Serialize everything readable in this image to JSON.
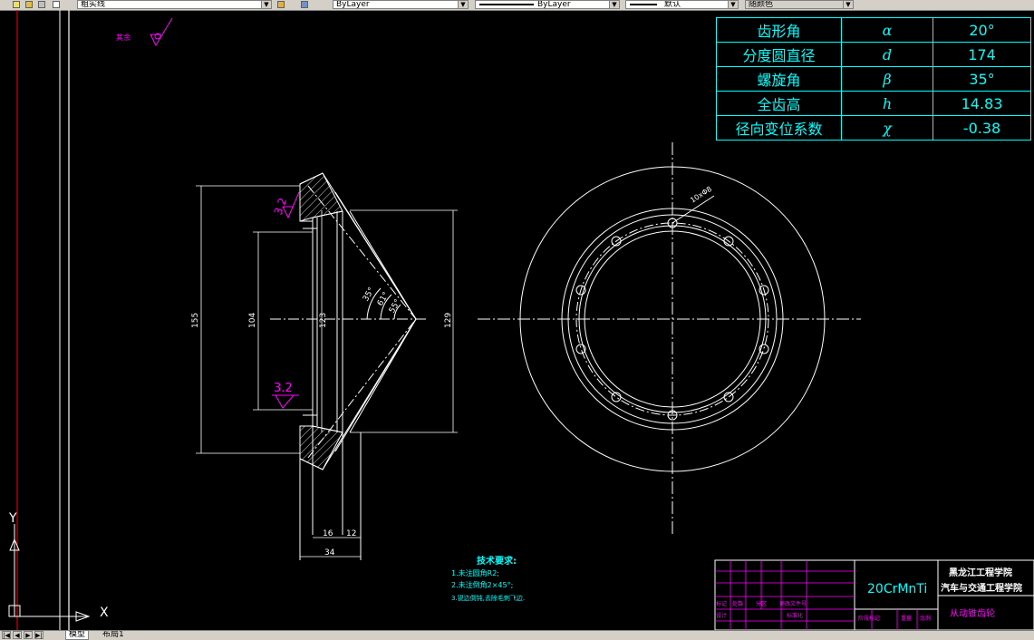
{
  "toolbar": {
    "layer_name": "粗实线",
    "color_control": "ByLayer",
    "linetype_control": "ByLayer",
    "lineweight_control": "默认",
    "plotstyle_control": "随颜色"
  },
  "layout_tabs": {
    "model": "模型",
    "layout1": "布局1"
  },
  "params": [
    {
      "name": "齿形角",
      "symbol": "α",
      "value": "20°"
    },
    {
      "name": "分度圆直径",
      "symbol": "d",
      "value": "174"
    },
    {
      "name": "螺旋角",
      "symbol": "β",
      "value": "35°"
    },
    {
      "name": "全齿高",
      "symbol": "h",
      "value": "14.83"
    },
    {
      "name": "径向变位系数",
      "symbol": "χ",
      "value": "-0.38"
    }
  ],
  "drawing": {
    "rough_mark_label": "其余",
    "roughness_upper": "3.2",
    "roughness_lower": "3.2",
    "dim_155": "155",
    "dim_104": "104",
    "dim_123": "123",
    "dim_129": "129",
    "dim_16": "16",
    "dim_12": "12",
    "dim_34": "34",
    "angle_1": "35°",
    "angle_2": "61°",
    "angle_3": "55°",
    "hole_callout": "10xΦ8",
    "ucs_y": "Y",
    "ucs_x": "X"
  },
  "notes": {
    "title": "技术要求:",
    "line1": "1.未注圆角R2;",
    "line2": "2.未注倒角2×45°;",
    "line3": "3.锐边倒钝,去除毛刺飞边."
  },
  "title_block": {
    "material": "20CrMnTi",
    "school": "黑龙江工程学院",
    "department": "汽车与交通工程学院",
    "part_name": "从动锥齿轮",
    "lbl_mark": "标记",
    "lbl_count": "处数",
    "lbl_zone": "分区",
    "lbl_docno": "更改文件号",
    "lbl_design": "设计",
    "lbl_standard": "标准化",
    "lbl_stage": "阶段标记",
    "lbl_weight": "重量",
    "lbl_scale": "比例"
  },
  "colors": {
    "background": "#000000",
    "lines": "#ffffff",
    "cyan": "#00ffff",
    "magenta": "#ff00ff",
    "red": "#ff0000"
  }
}
